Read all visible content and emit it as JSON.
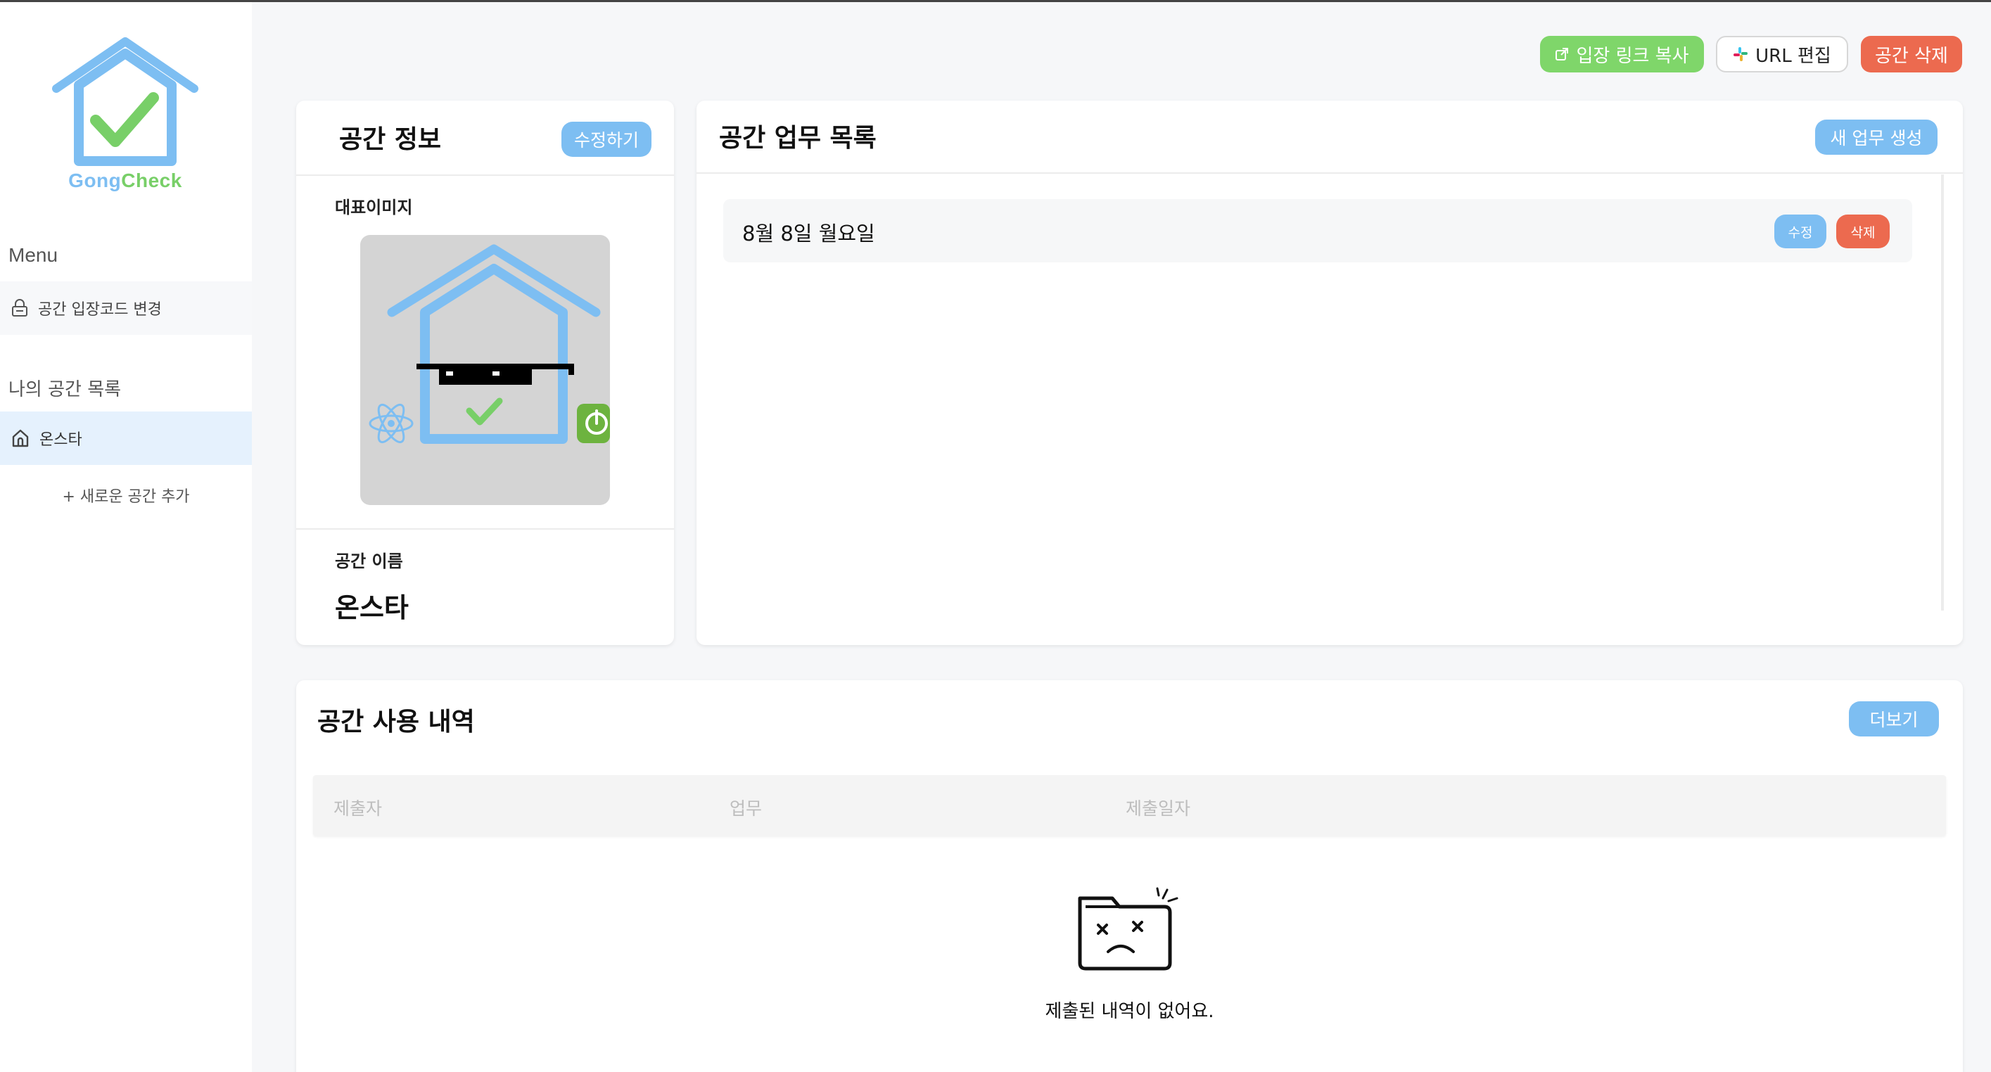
{
  "logo": {
    "part1": "Gong",
    "part2": "Check"
  },
  "sidebar": {
    "menu_title": "Menu",
    "items": [
      {
        "label": "공간 입장코드 변경",
        "icon": "lock-icon"
      }
    ],
    "section_title": "나의 공간 목록",
    "spaces": [
      {
        "label": "온스타",
        "icon": "home-icon",
        "selected": true
      }
    ],
    "add_space_label": "+ 새로운 공간 추가"
  },
  "toolbar": {
    "copy_link_label": "입장 링크 복사",
    "edit_url_label": "URL 편집",
    "delete_space_label": "공간 삭제"
  },
  "info": {
    "title": "공간 정보",
    "edit_label": "수정하기",
    "image_label": "대표이미지",
    "name_label": "공간 이름",
    "name_value": "온스타"
  },
  "tasks": {
    "title": "공간 업무 목록",
    "create_label": "새 업무 생성",
    "items": [
      {
        "name": "8월 8일 월요일",
        "edit_label": "수정",
        "delete_label": "삭제"
      }
    ]
  },
  "usage": {
    "title": "공간 사용 내역",
    "more_label": "더보기",
    "columns": [
      "제출자",
      "업무",
      "제출일자"
    ],
    "empty_text": "제출된 내역이 없어요."
  },
  "colors": {
    "primary": "#7dbef2",
    "green": "#7fd66a",
    "danger": "#ec6a4f"
  }
}
